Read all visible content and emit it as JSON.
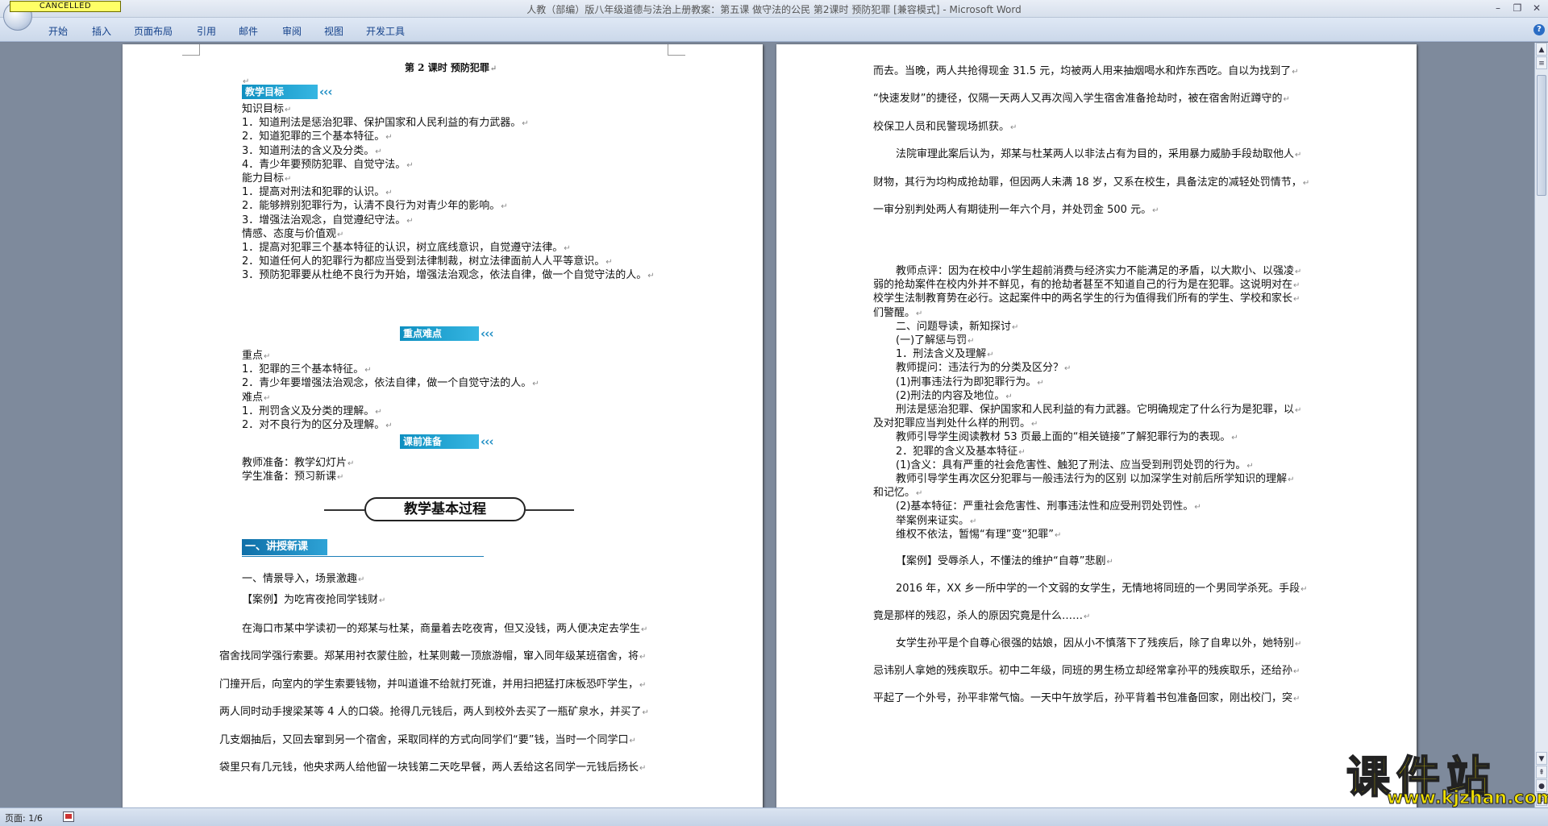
{
  "window": {
    "title": "人教（部编）版八年级道德与法治上册教案：第五课 做守法的公民 第2课时 预防犯罪 [兼容模式] - Microsoft Word",
    "stamp": "CANCELLED"
  },
  "ribbon": {
    "tabs": [
      "开始",
      "插入",
      "页面布局",
      "引用",
      "邮件",
      "审阅",
      "视图",
      "开发工具"
    ]
  },
  "left_page": {
    "title": "第 2 课时   预防犯罪",
    "banners": {
      "objectives": "教学目标",
      "keypoints": "重点难点",
      "prep": "课前准备"
    },
    "lines": [
      "知识目标",
      "1．知道刑法是惩治犯罪、保护国家和人民利益的有力武器。",
      "2．知道犯罪的三个基本特征。",
      "3．知道刑法的含义及分类。",
      "4．青少年要预防犯罪、自觉守法。",
      "能力目标",
      "1．提高对刑法和犯罪的认识。",
      "2．能够辨别犯罪行为，认清不良行为对青少年的影响。",
      "3．增强法治观念，自觉遵纪守法。",
      "情感、态度与价值观",
      "1．提高对犯罪三个基本特征的认识，树立底线意识，自觉遵守法律。",
      "2．知道任何人的犯罪行为都应当受到法律制裁，树立法律面前人人平等意识。",
      "3．预防犯罪要从杜绝不良行为开始，增强法治观念，依法自律，做一个自觉守法的人。"
    ],
    "lines_b": [
      "重点",
      "1．犯罪的三个基本特征。",
      "2．青少年要增强法治观念，依法自律，做一个自觉守法的人。",
      "难点",
      "1．刑罚含义及分类的理解。",
      "2．对不良行为的区分及理解。"
    ],
    "lines_c": [
      "教师准备：教学幻灯片",
      "学生准备：预习新课"
    ],
    "process_title": "教学基本过程",
    "section_heading": "一、讲授新课",
    "lines_d": [
      "一、情景导入，场景激趣",
      "【案例】为吃宵夜抢同学钱财",
      "在海口市某中学读初一的郑某与杜某，商量着去吃夜宵，但又没钱，两人便决定去学生",
      "宿舍找同学强行索要。郑某用衬衣蒙住脸，杜某则戴一顶旅游帽，窜入同年级某班宿舍，将",
      "门撞开后，向室内的学生索要钱物，并叫道谁不给就打死谁，并用扫把猛打床板恐吓学生，",
      "两人同时动手搜梁某等 4 人的口袋。抢得几元钱后，两人到校外去买了一瓶矿泉水，并买了",
      "几支烟抽后，又回去窜到另一个宿舍，采取同样的方式向同学们“要”钱，当时一个同学口",
      "袋里只有几元钱，他央求两人给他留一块钱第二天吃早餐，两人丢给这名同学一元钱后扬长"
    ]
  },
  "right_page": {
    "lines_sparse": [
      "而去。当晚，两人共抢得现金 31.5 元，均被两人用来抽烟喝水和炸东西吃。自以为找到了",
      "“快速发财”的捷径，仅隔一天两人又再次闯入学生宿舍准备抢劫时，被在宿舍附近蹲守的",
      "校保卫人员和民警现场抓获。",
      "法院审理此案后认为，郑某与杜某两人以非法占有为目的，采用暴力威胁手段劫取他人",
      "财物，其行为均构成抢劫罪，但因两人未满 18 岁，又系在校生，具备法定的减轻处罚情节，",
      "一审分别判处两人有期徒刑一年六个月，并处罚金 500 元。"
    ],
    "lines_dense": [
      "教师点评：因为在校中小学生超前消费与经济实力不能满足的矛盾，以大欺小、以强凌",
      "弱的抢劫案件在校内外并不鲜见，有的抢劫者甚至不知道自己的行为是在犯罪。这说明对在",
      "校学生法制教育势在必行。这起案件中的两名学生的行为值得我们所有的学生、学校和家长",
      "们警醒。",
      "二、问题导读，新知探讨",
      "(一)了解惩与罚",
      "1．刑法含义及理解",
      "教师提问：违法行为的分类及区分？",
      "(1)刑事违法行为即犯罪行为。",
      "(2)刑法的内容及地位。",
      "刑法是惩治犯罪、保护国家和人民利益的有力武器。它明确规定了什么行为是犯罪，以",
      "及对犯罪应当判处什么样的刑罚。",
      "教师引导学生阅读教材 53 页最上面的“相关链接”了解犯罪行为的表现。",
      "2．犯罪的含义及基本特征",
      "(1)含义：具有严重的社会危害性、触犯了刑法、应当受到刑罚处罚的行为。",
      "教师引导学生再次区分犯罪与一般违法行为的区别 以加深学生对前后所学知识的理解",
      "和记忆。",
      "(2)基本特征：严重社会危害性、刑事违法性和应受刑罚处罚性。",
      "举案例来证实。",
      "维权不依法，暂惕“有理”变“犯罪”"
    ],
    "lines_case": [
      "【案例】受辱杀人，不懂法的维护“自尊”悲剧",
      "2016 年，XX 乡一所中学的一个文弱的女学生，无情地将同班的一个男同学杀死。手段",
      "竟是那样的残忍，杀人的原因究竟是什么……",
      "女学生孙平是个自尊心很强的姑娘，因从小不慎落下了残疾后，除了自卑以外，她特别",
      "忌讳别人拿她的残疾取乐。初中二年级，同班的男生杨立却经常拿孙平的残疾取乐，还给孙",
      "平起了一个外号，孙平非常气恼。一天中午放学后，孙平背着书包准备回家，刚出校门，突"
    ]
  },
  "status": {
    "page": "页面: 1/6"
  },
  "watermark": {
    "logo": "课件站",
    "url": "www.kjzhan.com"
  }
}
